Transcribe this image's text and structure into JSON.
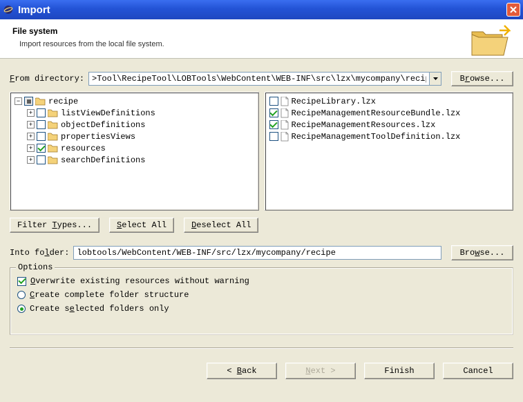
{
  "window": {
    "title": "Import"
  },
  "header": {
    "title": "File system",
    "description": "Import resources from the local file system."
  },
  "from_directory": {
    "label": "From directory:",
    "value": ">Tool\\RecipeTool\\LOBTools\\WebContent\\WEB-INF\\src\\lzx\\mycompany\\recipe",
    "browse_label": "Browse..."
  },
  "tree": {
    "items": [
      {
        "label": "recipe",
        "checked": "partial",
        "expandable": true,
        "expanded": true,
        "indent": 1
      },
      {
        "label": "listViewDefinitions",
        "checked": false,
        "expandable": true,
        "expanded": false,
        "indent": 2
      },
      {
        "label": "objectDefinitions",
        "checked": false,
        "expandable": true,
        "expanded": false,
        "indent": 2
      },
      {
        "label": "propertiesViews",
        "checked": false,
        "expandable": true,
        "expanded": false,
        "indent": 2
      },
      {
        "label": "resources",
        "checked": true,
        "expandable": true,
        "expanded": false,
        "indent": 2
      },
      {
        "label": "searchDefinitions",
        "checked": false,
        "expandable": true,
        "expanded": false,
        "indent": 2
      }
    ]
  },
  "files": {
    "items": [
      {
        "label": "RecipeLibrary.lzx",
        "checked": false
      },
      {
        "label": "RecipeManagementResourceBundle.lzx",
        "checked": true
      },
      {
        "label": "RecipeManagementResources.lzx",
        "checked": true
      },
      {
        "label": "RecipeManagementToolDefinition.lzx",
        "checked": false
      }
    ]
  },
  "buttons": {
    "filter_types": "Filter Types...",
    "select_all": "Select All",
    "deselect_all": "Deselect All"
  },
  "into_folder": {
    "label": "Into folder:",
    "value": "lobtools/WebContent/WEB-INF/src/lzx/mycompany/recipe",
    "browse_label": "Browse..."
  },
  "options": {
    "legend": "Options",
    "overwrite": {
      "label": "Overwrite existing resources without warning",
      "checked": true
    },
    "create_complete": {
      "label": "Create complete folder structure",
      "checked": false
    },
    "create_selected": {
      "label": "Create selected folders only",
      "checked": true
    }
  },
  "footer": {
    "back": "Back",
    "next": "Next",
    "finish": "Finish",
    "cancel": "Cancel"
  }
}
